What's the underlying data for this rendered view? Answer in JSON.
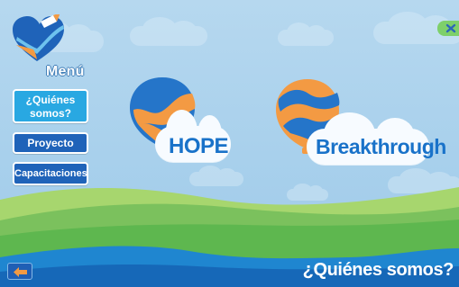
{
  "menu": {
    "title": "Menú",
    "items": [
      {
        "line1": "¿Quiénes",
        "line2": "somos?"
      },
      {
        "label": "Proyecto"
      },
      {
        "label": "Capacitaciones"
      }
    ]
  },
  "balloons": [
    {
      "label": "HOPE"
    },
    {
      "label": "Breakthrough"
    }
  ],
  "page": {
    "title": "¿Quiénes somos?"
  },
  "icons": {
    "logo": "heart-pen-logo",
    "back": "arrow-left-icon",
    "close": "close-icon"
  },
  "colors": {
    "sky": "#b6d8ef",
    "brand_blue": "#1f63b9",
    "active_blue": "#29a8e2",
    "balloon_blue": "#2575c9",
    "balloon_orange": "#f39a43",
    "grass": "#7bc15d",
    "water": "#1b7cc8"
  }
}
